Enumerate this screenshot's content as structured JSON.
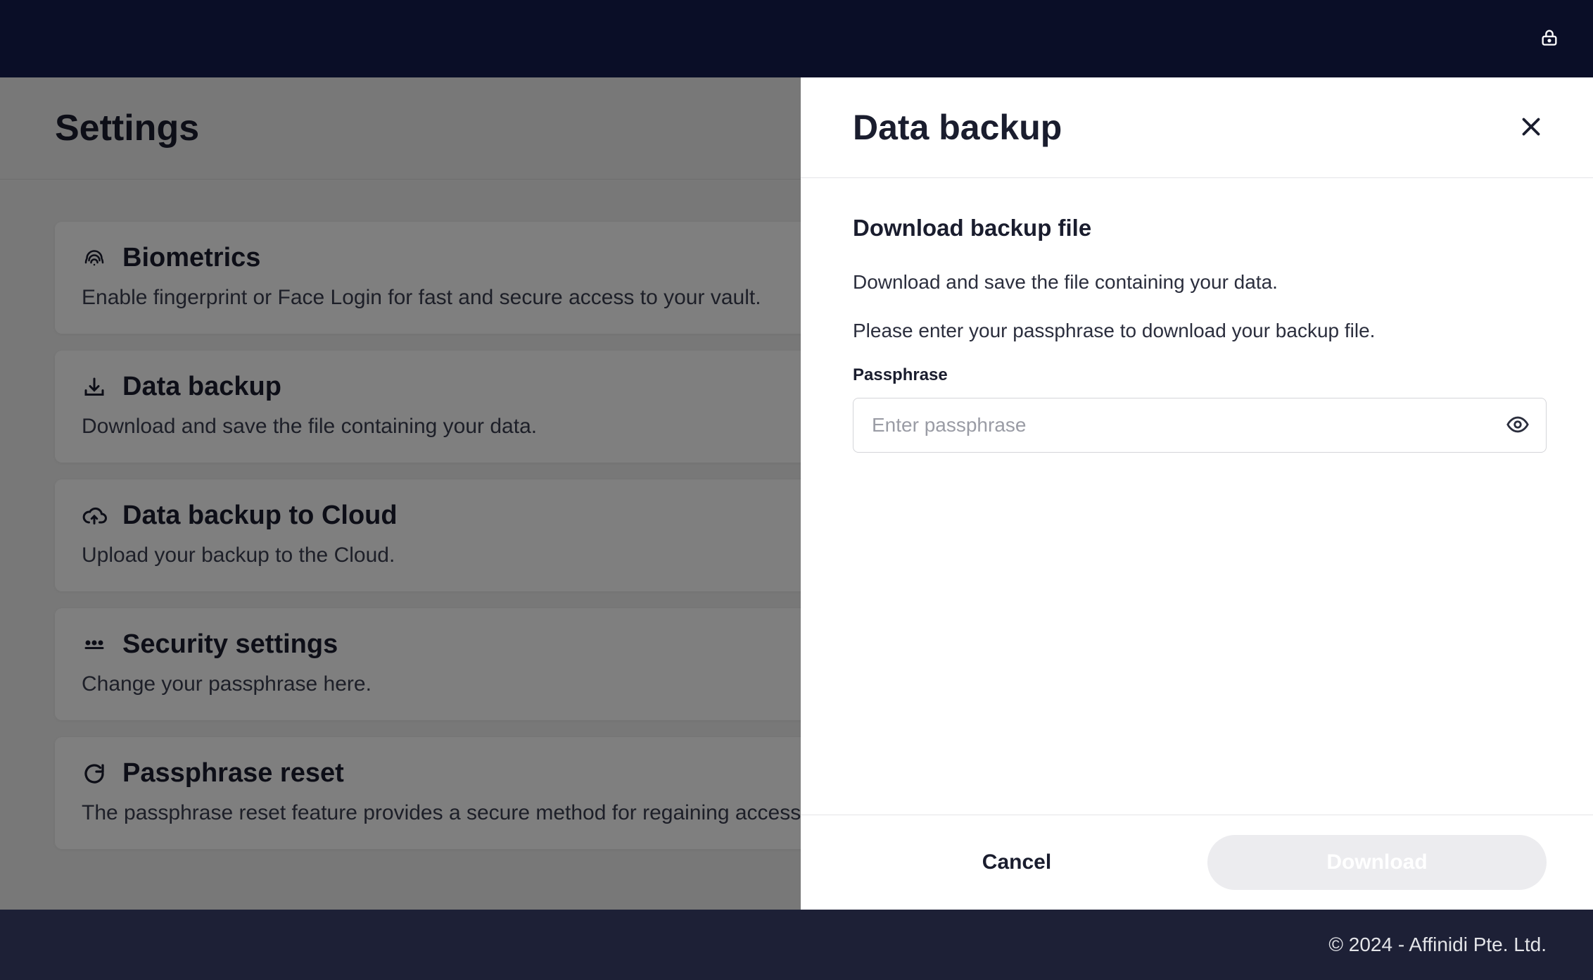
{
  "page": {
    "title": "Settings"
  },
  "cards": [
    {
      "title": "Biometrics",
      "desc": "Enable fingerprint or Face Login for fast and secure access to your vault."
    },
    {
      "title": "Data backup",
      "desc": "Download and save the file containing your data."
    },
    {
      "title": "Data backup to Cloud",
      "desc": "Upload your backup to the Cloud."
    },
    {
      "title": "Security settings",
      "desc": "Change your passphrase here."
    },
    {
      "title": "Passphrase reset",
      "desc": "The passphrase reset feature provides a secure method for regaining access to your vault."
    }
  ],
  "modal": {
    "title": "Data backup",
    "subtitle": "Download backup file",
    "text1": "Download and save the file containing your data.",
    "text2": "Please enter your passphrase to download your backup file.",
    "field_label": "Passphrase",
    "placeholder": "Enter passphrase",
    "cancel_label": "Cancel",
    "download_label": "Download"
  },
  "footer": {
    "text": "© 2024 - Affinidi Pte. Ltd."
  }
}
